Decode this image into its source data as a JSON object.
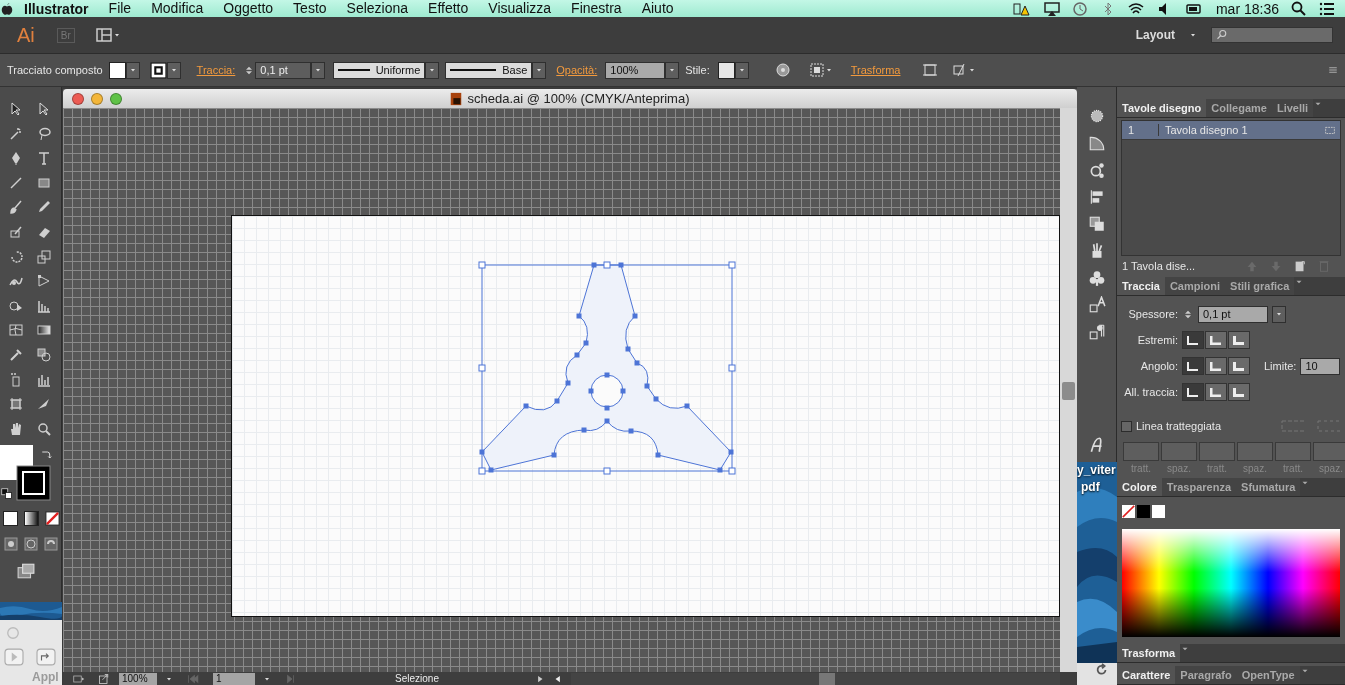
{
  "menu_bar": {
    "app_name": "Illustrator",
    "menus": [
      "File",
      "Modifica",
      "Oggetto",
      "Testo",
      "Seleziona",
      "Effetto",
      "Visualizza",
      "Finestra",
      "Aiuto"
    ],
    "clock": "mar 18:36"
  },
  "app_bar": {
    "logo": "Ai",
    "bridge": "Br",
    "workspace": "Layout"
  },
  "control_bar": {
    "object_type": "Tracciato composto",
    "stroke_label": "Traccia:",
    "stroke_weight": "0,1 pt",
    "profile": "Uniforme",
    "brush": "Base",
    "opacity_label": "Opacità:",
    "opacity": "100%",
    "style_label": "Stile:",
    "transform_link": "Trasforma"
  },
  "document": {
    "title": "scheda.ai @ 100% (CMYK/Anteprima)",
    "zoom": "100%",
    "artboard_number": "1",
    "status": "Selezione"
  },
  "desktop": {
    "file_label": [
      "y_viter",
      "pdf"
    ],
    "finder_label": "Appl"
  },
  "artboards_panel": {
    "tabs": [
      {
        "label": "Tavole disegno",
        "selected": true
      },
      {
        "label": "Collegame",
        "selected": false
      },
      {
        "label": "Livelli",
        "selected": false
      }
    ],
    "rows": [
      {
        "number": "1",
        "name": "Tavola disegno 1",
        "selected": true
      }
    ],
    "footer": "1 Tavola dise..."
  },
  "stroke_panel": {
    "tabs": [
      {
        "label": "Traccia",
        "selected": true
      },
      {
        "label": "Campioni",
        "selected": false
      },
      {
        "label": "Stili grafica",
        "selected": false
      }
    ],
    "weight_label": "Spessore:",
    "weight": "0,1 pt",
    "caps_label": "Estremi:",
    "caps": [
      {
        "selected": true
      },
      {
        "selected": false
      },
      {
        "selected": false
      }
    ],
    "corner_label": "Angolo:",
    "corners": [
      {
        "selected": true
      },
      {
        "selected": false
      },
      {
        "selected": false
      }
    ],
    "limit_label": "Limite:",
    "limit": "10",
    "align_label": "All. traccia:",
    "aligns": [
      {
        "selected": true
      },
      {
        "selected": false
      },
      {
        "selected": false
      }
    ],
    "dashed": {
      "label": "Linea tratteggiata",
      "checked": false
    },
    "dash_fields": [
      "tratt.",
      "spaz.",
      "tratt.",
      "spaz.",
      "tratt.",
      "spaz."
    ]
  },
  "color_panel": {
    "tabs": [
      {
        "label": "Colore",
        "selected": true
      },
      {
        "label": "Trasparenza",
        "selected": false
      },
      {
        "label": "Sfumatura",
        "selected": false
      }
    ]
  },
  "transform_panel": {
    "title": "Trasforma"
  },
  "character_panel": {
    "tabs": [
      {
        "label": "Carattere",
        "selected": true
      },
      {
        "label": "Paragrafo",
        "selected": false
      },
      {
        "label": "OpenType",
        "selected": false
      }
    ]
  }
}
